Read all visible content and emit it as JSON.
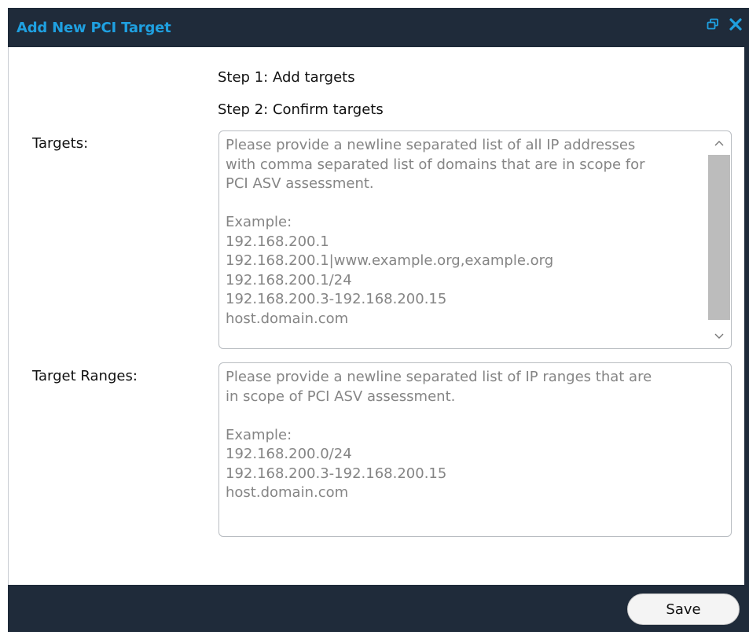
{
  "window": {
    "title": "Add New PCI Target",
    "icons": [
      "restore-icon",
      "close-icon"
    ],
    "colors": {
      "titlebar": "#1f2b3a",
      "title_text": "#1fa0e0",
      "accent": "#1fa0e0"
    }
  },
  "steps": {
    "step1": "Step 1: Add targets",
    "step2": "Step 2: Confirm targets"
  },
  "form": {
    "targets_label": "Targets:",
    "targets_placeholder": "Please provide a newline separated list of all IP addresses\nwith comma separated list of domains that are in scope for\nPCI ASV assessment.\n\nExample:\n192.168.200.1\n192.168.200.1|www.example.org,example.org\n192.168.200.1/24\n192.168.200.3-192.168.200.15\nhost.domain.com",
    "ranges_label": "Target Ranges:",
    "ranges_placeholder": "Please provide a newline separated list of IP ranges that are\nin scope of PCI ASV assessment.\n\nExample:\n192.168.200.0/24\n192.168.200.3-192.168.200.15\nhost.domain.com"
  },
  "footer": {
    "save_label": "Save"
  }
}
